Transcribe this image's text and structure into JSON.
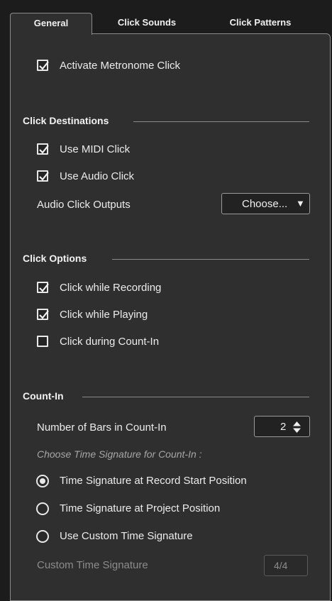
{
  "tabs": [
    {
      "label": "General",
      "active": true
    },
    {
      "label": "Click Sounds",
      "active": false
    },
    {
      "label": "Click Patterns",
      "active": false
    }
  ],
  "activate": {
    "label": "Activate Metronome Click",
    "checked": true
  },
  "click_destinations": {
    "heading": "Click Destinations",
    "use_midi": {
      "label": "Use MIDI Click",
      "checked": true
    },
    "use_audio": {
      "label": "Use Audio Click",
      "checked": true
    },
    "outputs_label": "Audio Click Outputs",
    "outputs_button": "Choose...",
    "outputs_arrow": "▼"
  },
  "click_options": {
    "heading": "Click Options",
    "while_recording": {
      "label": "Click while Recording",
      "checked": true
    },
    "while_playing": {
      "label": "Click while Playing",
      "checked": true
    },
    "during_count_in": {
      "label": "Click during Count-In",
      "checked": false
    }
  },
  "count_in": {
    "heading": "Count-In",
    "bars_label": "Number of Bars in Count-In",
    "bars_value": "2",
    "choose_sig_label": "Choose Time Signature for Count-In :",
    "radio_options": [
      {
        "label": "Time Signature at Record Start Position",
        "selected": true
      },
      {
        "label": "Time Signature at Project Position",
        "selected": false
      },
      {
        "label": "Use Custom Time Signature",
        "selected": false
      }
    ],
    "custom_sig_label": "Custom Time Signature",
    "custom_sig_value": "4/4"
  },
  "colors": {
    "background": "#1c1c1c",
    "panel": "#2f2f2f",
    "border": "#8a8a8a",
    "text": "#ececec",
    "muted": "#8c8c8c"
  }
}
